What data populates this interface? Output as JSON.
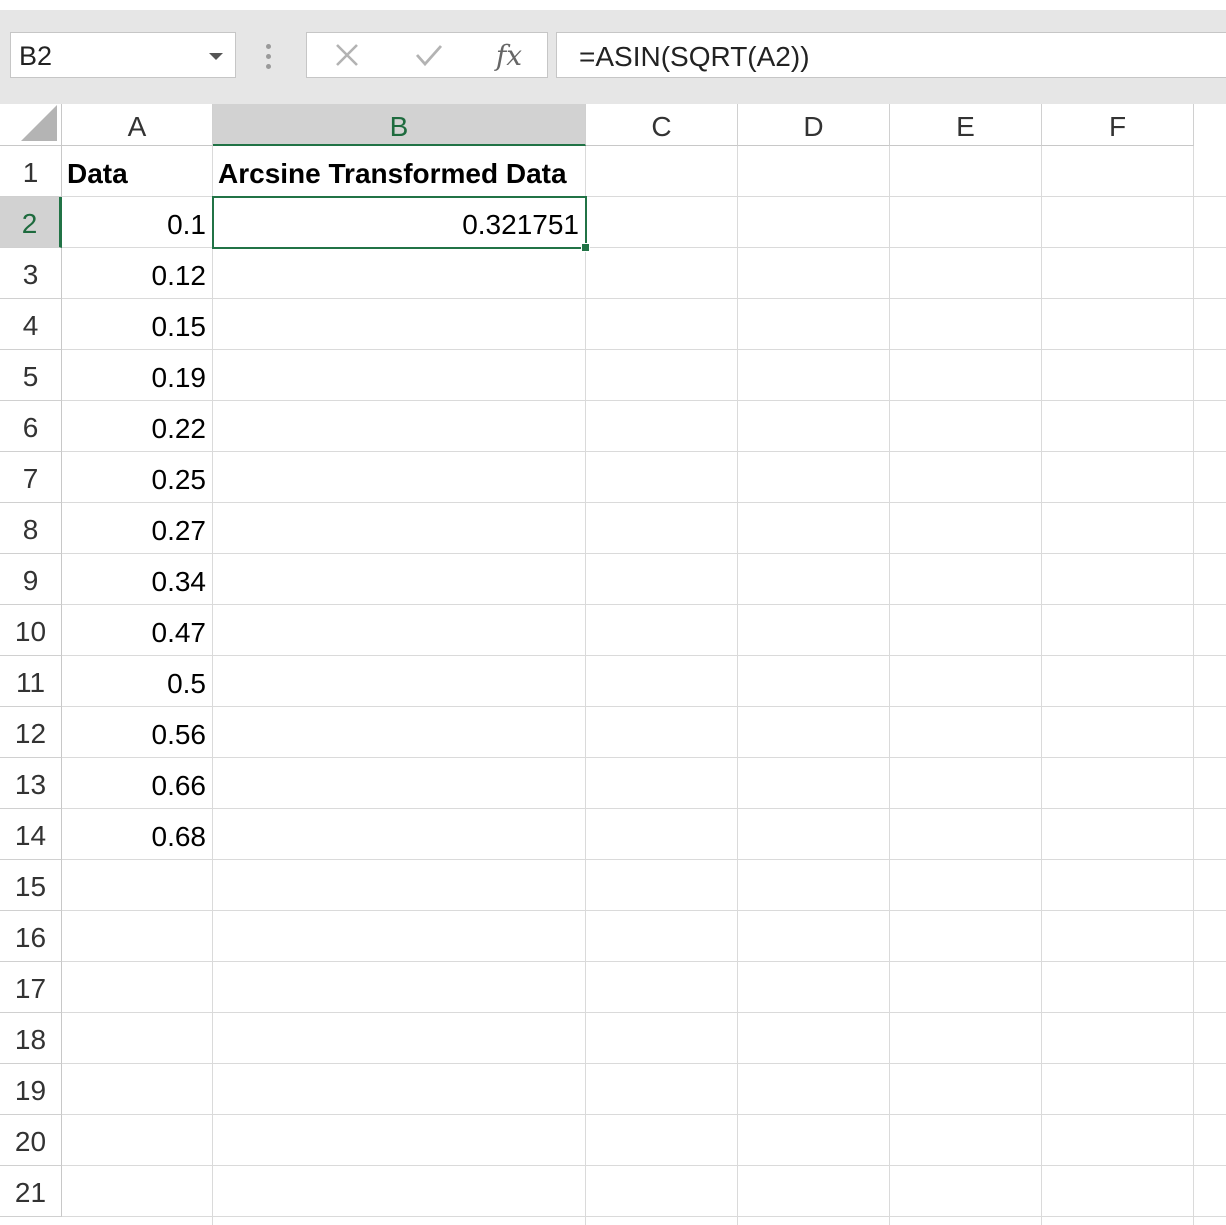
{
  "formula_bar": {
    "name_box": "B2",
    "formula": "=ASIN(SQRT(A2))",
    "fx_label": "fx"
  },
  "columns": [
    "A",
    "B",
    "C",
    "D",
    "E",
    "F"
  ],
  "rows": [
    "1",
    "2",
    "3",
    "4",
    "5",
    "6",
    "7",
    "8",
    "9",
    "10",
    "11",
    "12",
    "13",
    "14",
    "15",
    "16",
    "17",
    "18",
    "19",
    "20",
    "21"
  ],
  "active_cell": {
    "column": "B",
    "row": "2"
  },
  "sheet": {
    "A1": "Data",
    "B1": "Arcsine Transformed Data",
    "A_values": [
      "0.1",
      "0.12",
      "0.15",
      "0.19",
      "0.22",
      "0.25",
      "0.27",
      "0.34",
      "0.47",
      "0.5",
      "0.56",
      "0.66",
      "0.68"
    ],
    "B2": "0.321751"
  },
  "colors": {
    "accent": "#217346",
    "header_selected": "#d2d2d2",
    "gridline": "#dadada"
  }
}
